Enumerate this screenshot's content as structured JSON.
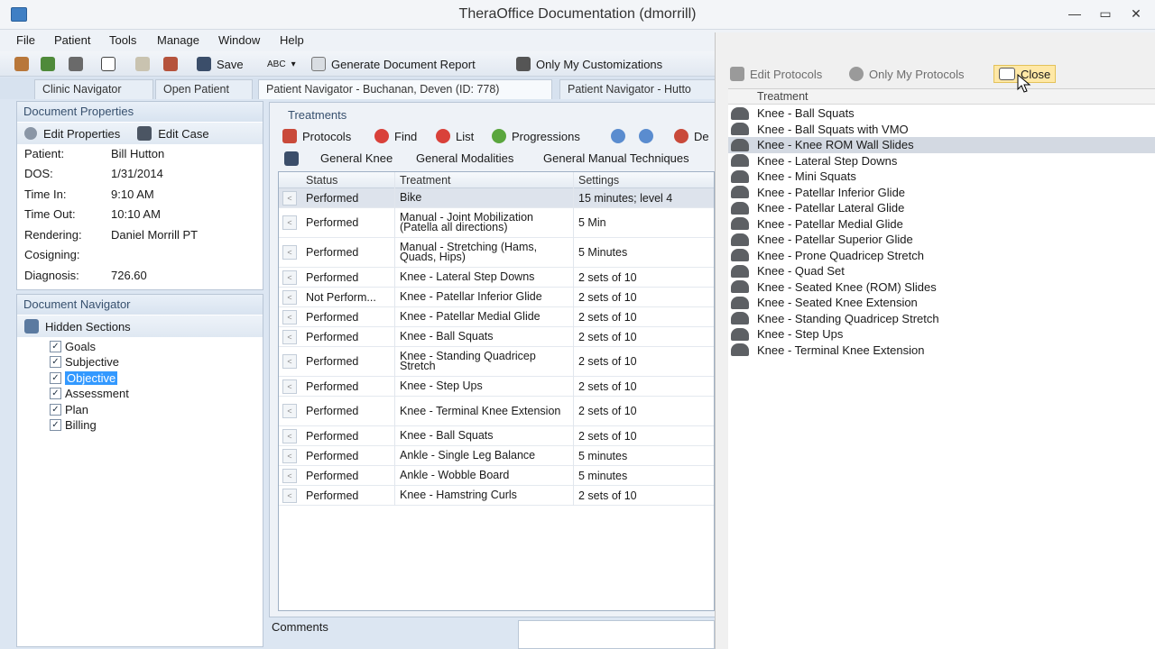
{
  "window": {
    "title": "TheraOffice Documentation (dmorrill)",
    "minimize": "—",
    "maximize": "▭",
    "close": "✕"
  },
  "menu": [
    "File",
    "Patient",
    "Tools",
    "Manage",
    "Window",
    "Help"
  ],
  "toolbar": {
    "save": "Save",
    "spell": "ABC",
    "generate_report": "Generate Document Report",
    "only_my_customizations": "Only My Customizations"
  },
  "tabs": [
    "Clinic Navigator",
    "Open Patient",
    "Patient Navigator - Buchanan, Deven (ID: 778)",
    "Patient Navigator - Hutto"
  ],
  "doc_props": {
    "header": "Document Properties",
    "edit_properties": "Edit Properties",
    "edit_case": "Edit Case",
    "rows": [
      {
        "label": "Patient:",
        "value": "Bill Hutton"
      },
      {
        "label": "DOS:",
        "value": "1/31/2014"
      },
      {
        "label": "Time In:",
        "value": "9:10 AM"
      },
      {
        "label": "Time Out:",
        "value": "10:10 AM"
      },
      {
        "label": "Rendering:",
        "value": "Daniel  Morrill PT"
      },
      {
        "label": "Cosigning:",
        "value": ""
      },
      {
        "label": "Diagnosis:",
        "value": "726.60"
      }
    ]
  },
  "doc_nav": {
    "header": "Document Navigator",
    "hidden_sections": "Hidden Sections",
    "items": [
      "Goals",
      "Subjective",
      "Objective",
      "Assessment",
      "Plan",
      "Billing"
    ],
    "selected": "Objective"
  },
  "treatments": {
    "legend": "Treatments",
    "toolbar": {
      "protocols": "Protocols",
      "find": "Find",
      "list": "List",
      "progressions": "Progressions",
      "delete": "De"
    },
    "categories": [
      "General Knee",
      "General Modalities",
      "General Manual Techniques"
    ],
    "columns": [
      "Status",
      "Treatment",
      "Settings"
    ],
    "rows": [
      {
        "status": "Performed",
        "treatment": "Bike",
        "settings": "15 minutes; level 4"
      },
      {
        "status": "Performed",
        "treatment": "Manual - Joint Mobilization (Patella all directions)",
        "settings": "5 Min"
      },
      {
        "status": "Performed",
        "treatment": "Manual - Stretching (Hams, Quads, Hips)",
        "settings": "5 Minutes"
      },
      {
        "status": "Performed",
        "treatment": "Knee - Lateral Step Downs",
        "settings": "2 sets of 10"
      },
      {
        "status": "Not Perform...",
        "treatment": "Knee - Patellar Inferior Glide",
        "settings": "2 sets of 10"
      },
      {
        "status": "Performed",
        "treatment": "Knee - Patellar Medial Glide",
        "settings": "2 sets of 10"
      },
      {
        "status": "Performed",
        "treatment": "Knee - Ball Squats",
        "settings": "2 sets of 10"
      },
      {
        "status": "Performed",
        "treatment": "Knee - Standing Quadricep Stretch",
        "settings": "2 sets of 10"
      },
      {
        "status": "Performed",
        "treatment": "Knee - Step Ups",
        "settings": "2 sets of 10"
      },
      {
        "status": "Performed",
        "treatment": "Knee - Terminal Knee Extension",
        "settings": "2 sets of 10"
      },
      {
        "status": "Performed",
        "treatment": "Knee - Ball Squats",
        "settings": "2 sets of 10"
      },
      {
        "status": "Performed",
        "treatment": "Ankle - Single Leg Balance",
        "settings": "5 minutes"
      },
      {
        "status": "Performed",
        "treatment": "Ankle - Wobble Board",
        "settings": "5 minutes"
      },
      {
        "status": "Performed",
        "treatment": "Knee - Hamstring Curls",
        "settings": "2 sets of 10"
      }
    ],
    "comments_label": "Comments"
  },
  "protocols_pane": {
    "edit_protocols": "Edit Protocols",
    "only_my_protocols": "Only My Protocols",
    "close": "Close",
    "column": "Treatment",
    "items": [
      "Knee - Ball Squats",
      "Knee - Ball Squats with VMO",
      "Knee - Knee ROM Wall Slides",
      "Knee - Lateral Step Downs",
      "Knee - Mini Squats",
      "Knee - Patellar Inferior Glide",
      "Knee - Patellar Lateral Glide",
      "Knee - Patellar Medial Glide",
      "Knee - Patellar Superior Glide",
      "Knee - Prone Quadricep Stretch",
      "Knee - Quad Set",
      "Knee - Seated Knee (ROM) Slides",
      "Knee - Seated Knee Extension",
      "Knee - Standing Quadricep Stretch",
      "Knee - Step Ups",
      "Knee - Terminal Knee Extension"
    ],
    "selected": "Knee - Knee ROM Wall Slides"
  }
}
